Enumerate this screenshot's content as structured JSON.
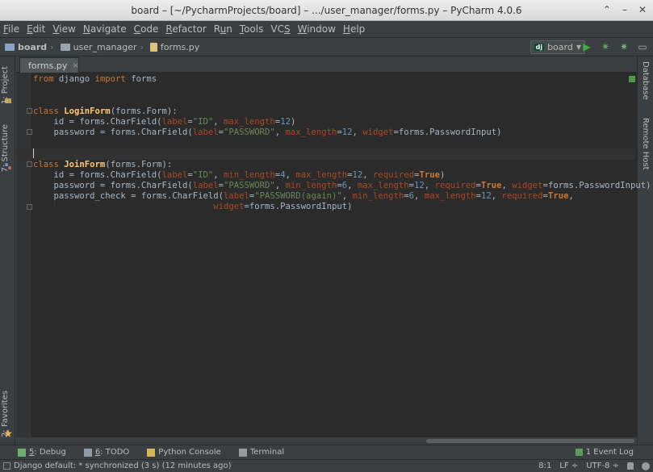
{
  "window": {
    "title": "board – [~/PycharmProjects/board] – .../user_manager/forms.py – PyCharm 4.0.6",
    "controls": [
      "⌃",
      "–",
      "✕"
    ]
  },
  "menu": [
    {
      "pre": "",
      "u": "F",
      "post": "ile"
    },
    {
      "pre": "",
      "u": "E",
      "post": "dit"
    },
    {
      "pre": "",
      "u": "V",
      "post": "iew"
    },
    {
      "pre": "",
      "u": "N",
      "post": "avigate"
    },
    {
      "pre": "",
      "u": "C",
      "post": "ode"
    },
    {
      "pre": "",
      "u": "R",
      "post": "efactor"
    },
    {
      "pre": "R",
      "u": "u",
      "post": "n"
    },
    {
      "pre": "",
      "u": "T",
      "post": "ools"
    },
    {
      "pre": "VC",
      "u": "S",
      "post": ""
    },
    {
      "pre": "",
      "u": "W",
      "post": "indow"
    },
    {
      "pre": "",
      "u": "H",
      "post": "elp"
    }
  ],
  "breadcrumb": {
    "project": "board",
    "folder": "user_manager",
    "file": "forms.py",
    "separator": "›"
  },
  "run_config": {
    "badge": "dj",
    "label": "board",
    "arrow": "▼"
  },
  "toolbar_icons": [
    "▶",
    "✷",
    "✷",
    "▭"
  ],
  "editor_tab": {
    "label": "forms.py",
    "close": "×"
  },
  "code_lines": [
    [
      [
        "kw",
        "from"
      ],
      [
        "t",
        " django "
      ],
      [
        "kw",
        "import"
      ],
      [
        "t",
        " forms"
      ]
    ],
    [],
    [],
    [
      [
        "kw",
        "class"
      ],
      [
        "t",
        " "
      ],
      [
        "cls",
        "LoginForm"
      ],
      [
        "t",
        "(forms.Form):"
      ]
    ],
    [
      [
        "t",
        "    id = forms.CharField("
      ],
      [
        "pk",
        "label"
      ],
      [
        "t",
        "="
      ],
      [
        "str",
        "\"ID\""
      ],
      [
        "t",
        ", "
      ],
      [
        "pk",
        "max_length"
      ],
      [
        "t",
        "="
      ],
      [
        "num",
        "12"
      ],
      [
        "t",
        ")"
      ]
    ],
    [
      [
        "t",
        "    password = forms.CharField("
      ],
      [
        "pk",
        "label"
      ],
      [
        "t",
        "="
      ],
      [
        "str",
        "\"PASSWORD\""
      ],
      [
        "t",
        ", "
      ],
      [
        "pk",
        "max_length"
      ],
      [
        "t",
        "="
      ],
      [
        "num",
        "12"
      ],
      [
        "t",
        ", "
      ],
      [
        "pk",
        "widget"
      ],
      [
        "t",
        "=forms.PasswordInput)"
      ]
    ],
    [],
    [],
    [
      [
        "kw",
        "class"
      ],
      [
        "t",
        " "
      ],
      [
        "cls",
        "JoinForm"
      ],
      [
        "t",
        "(forms.Form):"
      ]
    ],
    [
      [
        "t",
        "    id = forms.CharField("
      ],
      [
        "pk",
        "label"
      ],
      [
        "t",
        "="
      ],
      [
        "str",
        "\"ID\""
      ],
      [
        "t",
        ", "
      ],
      [
        "pk",
        "min_length"
      ],
      [
        "t",
        "="
      ],
      [
        "num",
        "4"
      ],
      [
        "t",
        ", "
      ],
      [
        "pk",
        "max_length"
      ],
      [
        "t",
        "="
      ],
      [
        "num",
        "12"
      ],
      [
        "t",
        ", "
      ],
      [
        "pk",
        "required"
      ],
      [
        "t",
        "="
      ],
      [
        "tru",
        "True"
      ],
      [
        "t",
        ")"
      ]
    ],
    [
      [
        "t",
        "    password = forms.CharField("
      ],
      [
        "pk",
        "label"
      ],
      [
        "t",
        "="
      ],
      [
        "str",
        "\"PASSWORD\""
      ],
      [
        "t",
        ", "
      ],
      [
        "pk",
        "min_length"
      ],
      [
        "t",
        "="
      ],
      [
        "num",
        "6"
      ],
      [
        "t",
        ", "
      ],
      [
        "pk",
        "max_length"
      ],
      [
        "t",
        "="
      ],
      [
        "num",
        "12"
      ],
      [
        "t",
        ", "
      ],
      [
        "pk",
        "required"
      ],
      [
        "t",
        "="
      ],
      [
        "tru",
        "True"
      ],
      [
        "t",
        ", "
      ],
      [
        "pk",
        "widget"
      ],
      [
        "t",
        "=forms.PasswordInput)"
      ]
    ],
    [
      [
        "t",
        "    password_check = forms.CharField("
      ],
      [
        "pk",
        "label"
      ],
      [
        "t",
        "="
      ],
      [
        "str",
        "\"PASSWORD(again)\""
      ],
      [
        "t",
        ", "
      ],
      [
        "pk",
        "min_length"
      ],
      [
        "t",
        "="
      ],
      [
        "num",
        "6"
      ],
      [
        "t",
        ", "
      ],
      [
        "pk",
        "max_length"
      ],
      [
        "t",
        "="
      ],
      [
        "num",
        "12"
      ],
      [
        "t",
        ", "
      ],
      [
        "pk",
        "required"
      ],
      [
        "t",
        "="
      ],
      [
        "tru",
        "True"
      ],
      [
        "t",
        ","
      ]
    ],
    [
      [
        "t",
        "                                   "
      ],
      [
        "pk",
        "widget"
      ],
      [
        "t",
        "=forms.PasswordInput)"
      ]
    ]
  ],
  "left_tools": {
    "project": "1: Project",
    "structure": "7: Structure",
    "favorites": "2: Favorites"
  },
  "right_tools": {
    "database": "Database",
    "remote": "Remote Host"
  },
  "tool_windows": [
    {
      "u": "5",
      "post": ": Debug"
    },
    {
      "u": "6",
      "post": ": TODO"
    },
    {
      "u": "",
      "post": "Python Console"
    },
    {
      "u": "",
      "post": "Terminal"
    }
  ],
  "event_log": "1 Event Log",
  "status": {
    "message": "Django default: * synchronized (3 s) (12 minutes ago)",
    "position": "8:1",
    "line_sep": "LF ÷",
    "encoding": "UTF-8 ÷"
  },
  "colors": {
    "background": "#2b2b2b",
    "keyword": "#cc7832",
    "string": "#6a8759",
    "param": "#aa4926",
    "number": "#6897bb",
    "class": "#ffc66d",
    "run": "#3fae3f"
  }
}
